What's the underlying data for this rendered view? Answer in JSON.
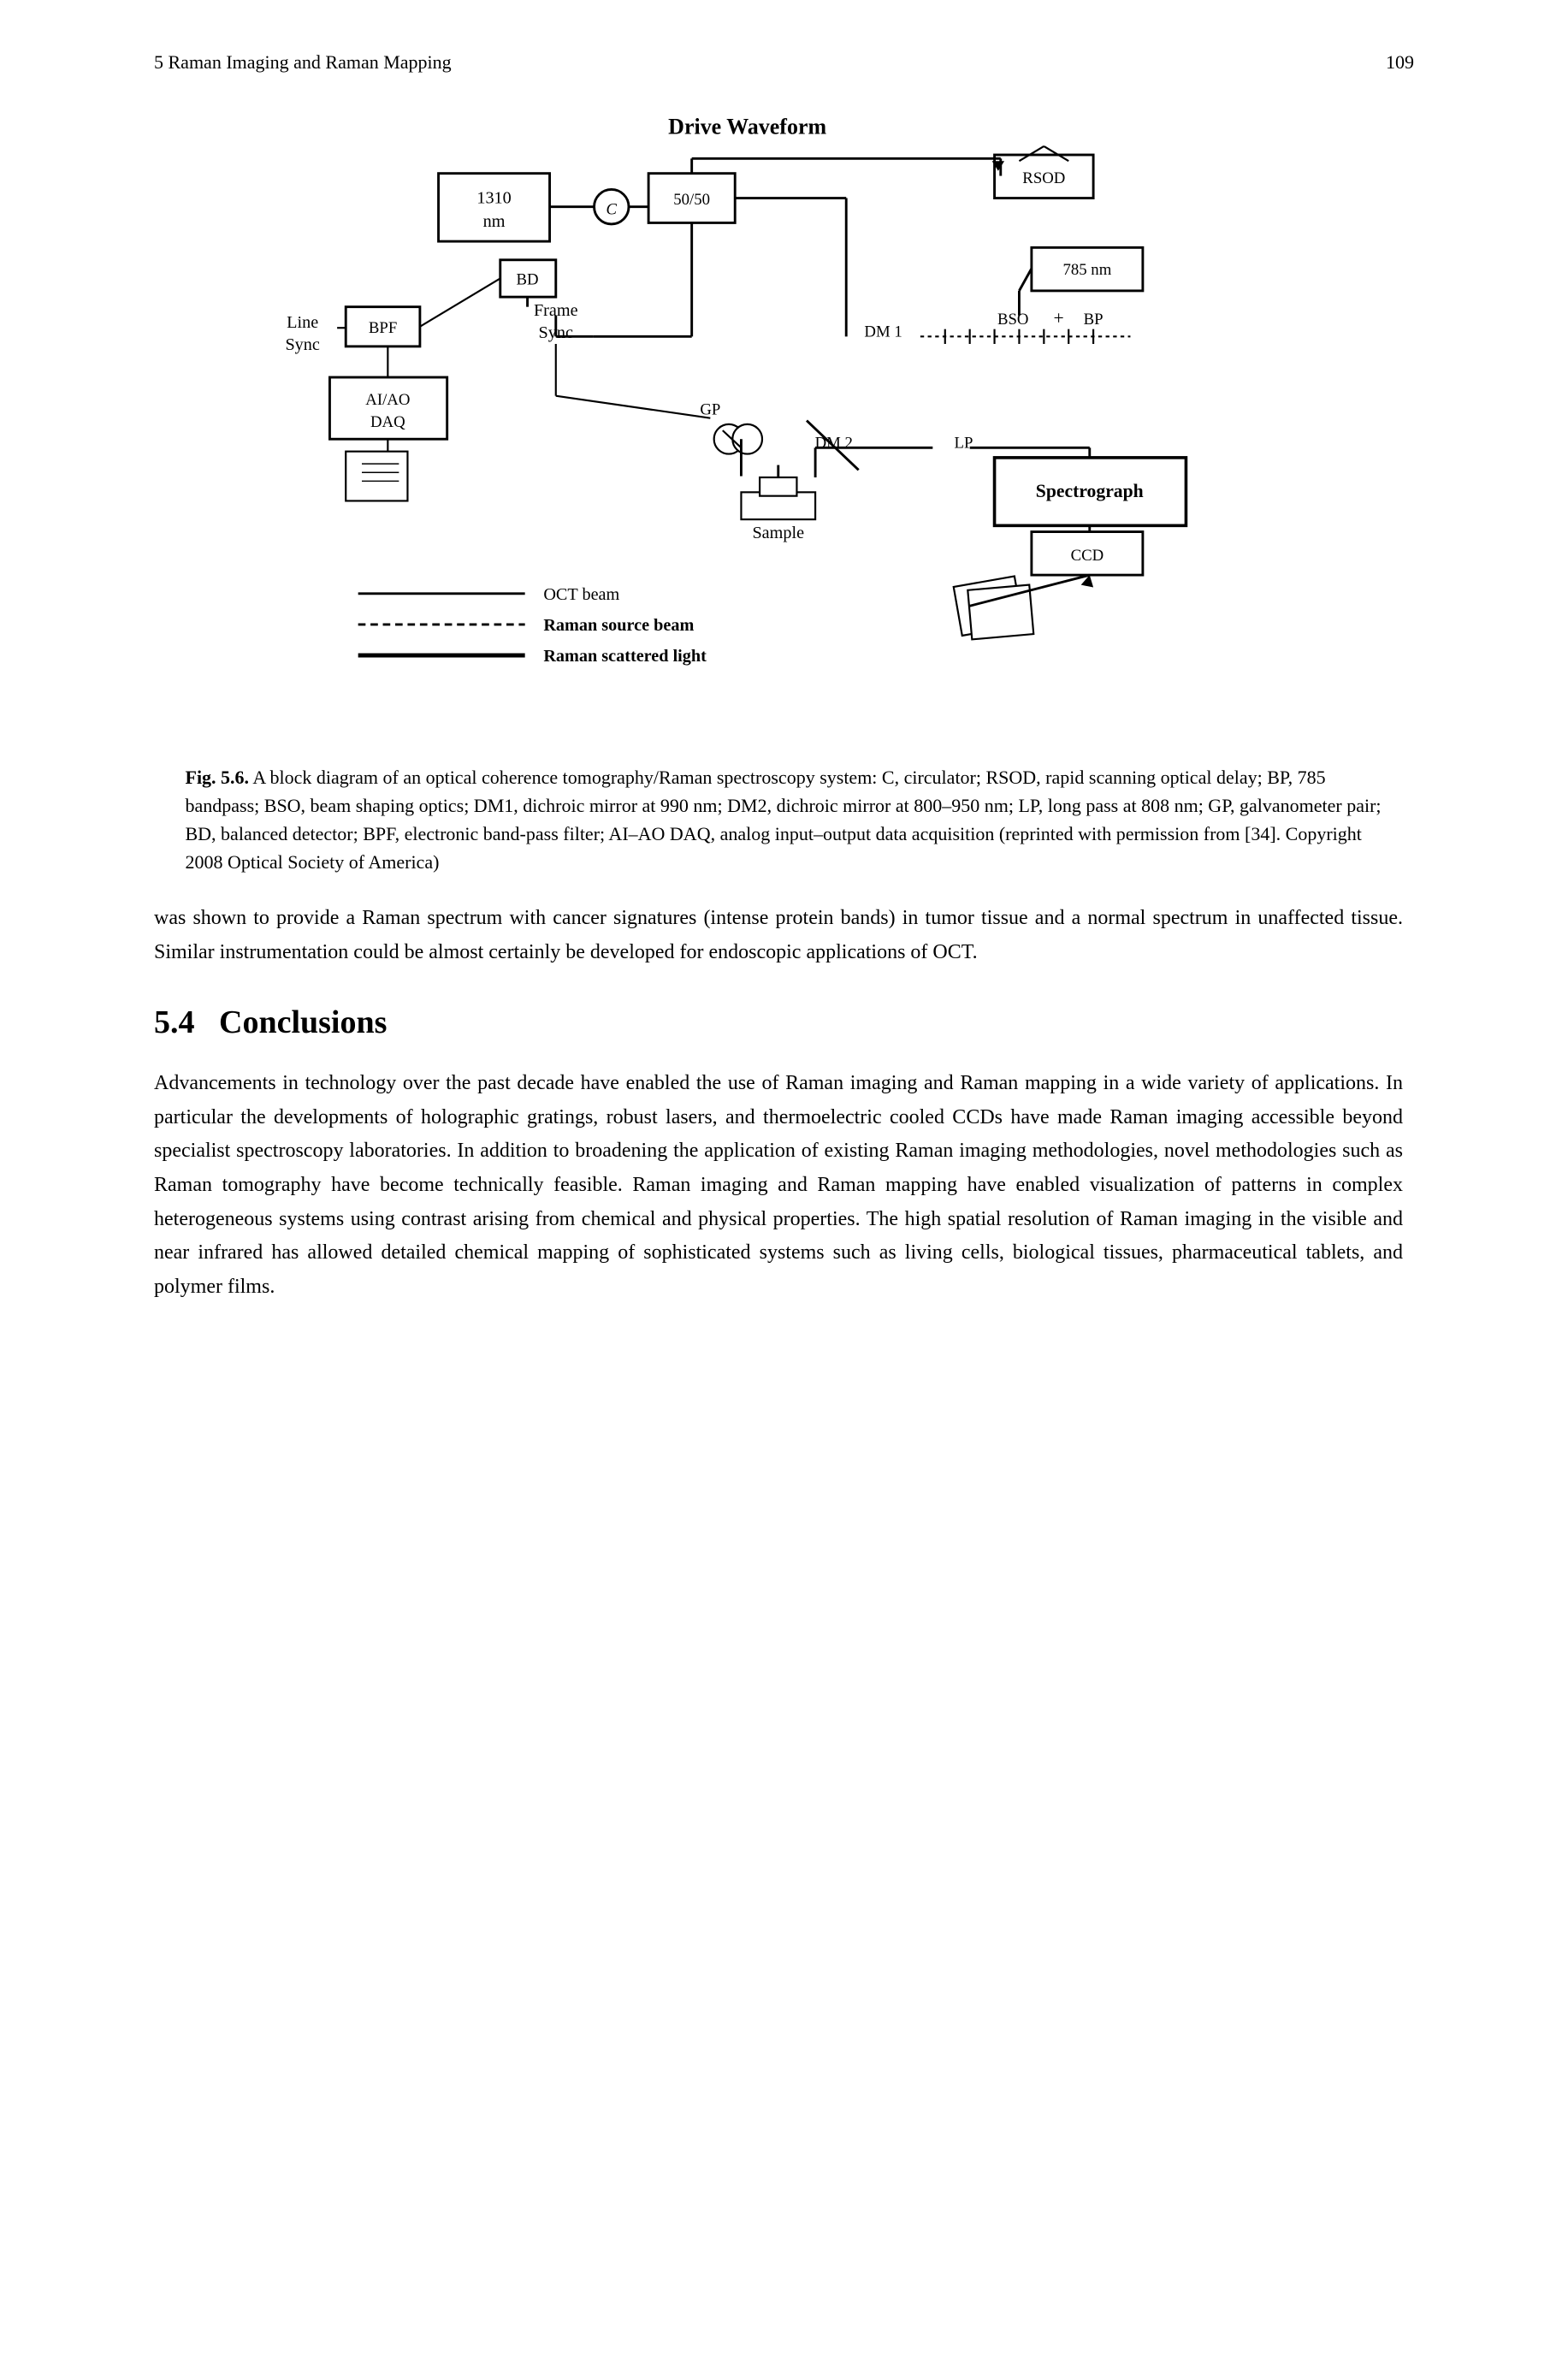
{
  "header": {
    "chapter_title": "5  Raman Imaging and Raman Mapping",
    "page_number": "109"
  },
  "figure": {
    "label": "Fig. 5.6.",
    "caption": "A block diagram of an optical coherence tomography/Raman spectroscopy system: C, circulator; RSOD, rapid scanning optical delay; BP, 785 bandpass; BSO, beam shaping optics; DM1, dichroic mirror at 990 nm; DM2, dichroic mirror at 800–950 nm; LP, long pass at 808 nm; GP, galvanometer pair; BD, balanced detector; BPF, electronic band-pass filter; AI–AO DAQ, analog input–output data acquisition (reprinted with permission from [34]. Copyright 2008 Optical Society of America)"
  },
  "body_text_1": "was shown to provide a Raman spectrum with cancer signatures (intense protein bands) in tumor tissue and a normal spectrum in unaffected tissue. Similar instrumentation could be almost certainly be developed for endoscopic applications of OCT.",
  "section": {
    "number": "5.4",
    "title": "Conclusions"
  },
  "body_text_2": "Advancements in technology over the past decade have enabled the use of Raman imaging and Raman mapping in a wide variety of applications. In particular the developments of holographic gratings, robust lasers, and thermoelectric cooled CCDs have made Raman imaging accessible beyond specialist spectroscopy laboratories. In addition to broadening the application of existing Raman imaging methodologies, novel methodologies such as Raman tomography have become technically feasible. Raman imaging and Raman mapping have enabled visualization of patterns in complex heterogeneous systems using contrast arising from chemical and physical properties. The high spatial resolution of Raman imaging in the visible and near infrared has allowed detailed chemical mapping of sophisticated systems such as living cells, biological tissues, pharmaceutical tablets, and polymer films.",
  "diagram": {
    "title": "Drive Waveform",
    "labels": {
      "rsod": "RSOD",
      "nm785": "785 nm",
      "bso": "BSO",
      "bp": "BP",
      "dm1": "DM 1",
      "dm2": "DM 2",
      "lp": "LP",
      "gp": "GP",
      "spectrograph": "Spectrograph",
      "ccd": "CCD",
      "sample": "Sample",
      "bpf": "BPF",
      "aiaodaq": "AI/AO\nDAQ",
      "bd": "BD",
      "linesync": "Line\nSync",
      "framesync": "Frame\nSync",
      "nm1310": "1310\nnm",
      "nm5050": "50/50",
      "oct_beam": "OCT beam",
      "raman_source": "Raman source beam",
      "raman_scattered": "Raman scattered light"
    }
  }
}
